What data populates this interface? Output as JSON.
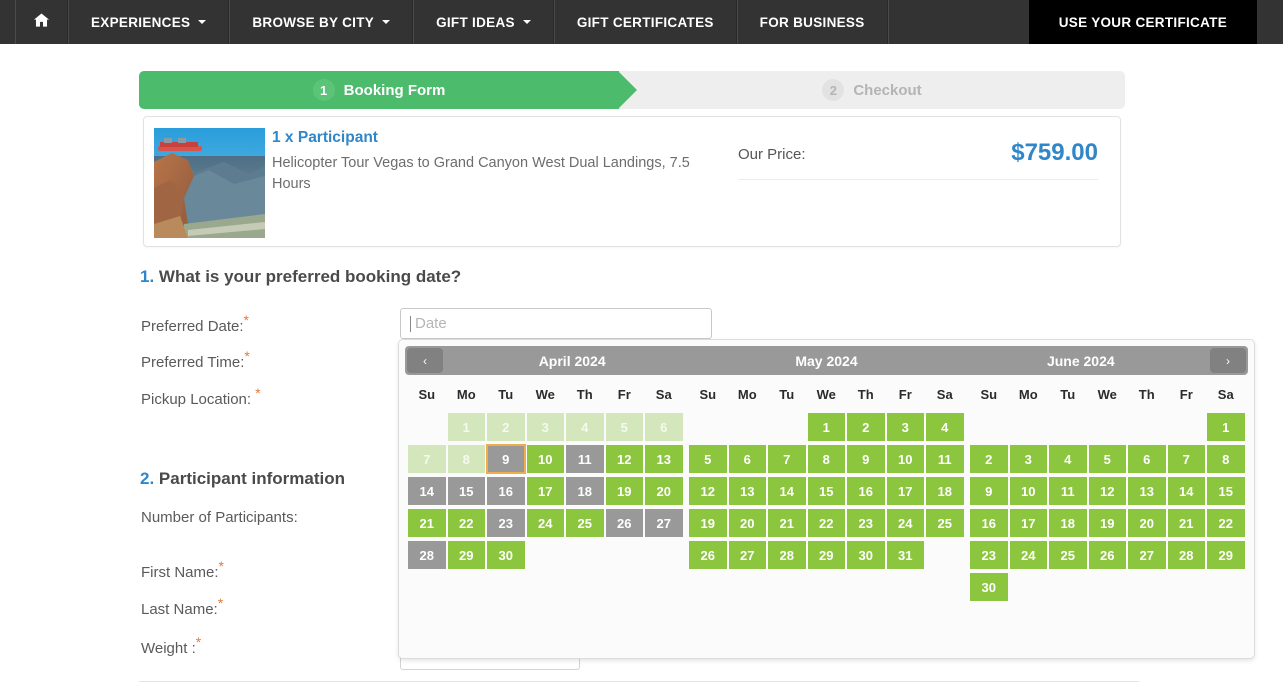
{
  "nav": {
    "home_icon": "home-icon",
    "items": [
      {
        "label": "EXPERIENCES",
        "has_caret": true
      },
      {
        "label": "BROWSE BY CITY",
        "has_caret": true
      },
      {
        "label": "GIFT IDEAS",
        "has_caret": true
      },
      {
        "label": "GIFT CERTIFICATES",
        "has_caret": false
      },
      {
        "label": "FOR BUSINESS",
        "has_caret": false
      }
    ],
    "cta_label": "USE YOUR CERTIFICATE"
  },
  "steps": [
    {
      "number": "1",
      "label": "Booking Form",
      "state": "active"
    },
    {
      "number": "2",
      "label": "Checkout",
      "state": "inactive"
    }
  ],
  "product": {
    "title": "1 x Participant",
    "description": "Helicopter Tour Vegas to Grand Canyon West Dual Landings, 7.5 Hours",
    "price_label": "Our Price:",
    "price_value": "$759.00",
    "thumb_alt": "grand-canyon-skywalk-photo"
  },
  "sections": [
    {
      "number": "1.",
      "heading": "What is your preferred booking date?",
      "fields": [
        {
          "label": "Preferred Date:",
          "required": "*"
        },
        {
          "label": "Preferred Time:",
          "required": "*"
        },
        {
          "label": "Pickup Location: ",
          "required": "*"
        }
      ]
    },
    {
      "number": "2.",
      "heading": "Participant information",
      "fields": [
        {
          "label": "Number of Participants:",
          "required": ""
        },
        {
          "label": "First Name:",
          "required": "*"
        },
        {
          "label": "Last Name:",
          "required": "*"
        },
        {
          "label": "Weight :",
          "required": "*"
        }
      ]
    }
  ],
  "date_input": {
    "value": "",
    "placeholder": "Date"
  },
  "datepicker": {
    "prev_label": "‹",
    "next_label": "›",
    "dow": [
      "Su",
      "Mo",
      "Tu",
      "We",
      "Th",
      "Fr",
      "Sa"
    ],
    "months": [
      {
        "title": "April 2024",
        "weeks": [
          [
            {
              "d": "",
              "s": "empty"
            },
            {
              "d": "1",
              "s": "disabled"
            },
            {
              "d": "2",
              "s": "disabled"
            },
            {
              "d": "3",
              "s": "disabled"
            },
            {
              "d": "4",
              "s": "disabled"
            },
            {
              "d": "5",
              "s": "disabled"
            },
            {
              "d": "6",
              "s": "disabled"
            }
          ],
          [
            {
              "d": "7",
              "s": "disabled"
            },
            {
              "d": "8",
              "s": "disabled"
            },
            {
              "d": "9",
              "s": "today"
            },
            {
              "d": "10",
              "s": "avail"
            },
            {
              "d": "11",
              "s": "unavail"
            },
            {
              "d": "12",
              "s": "avail"
            },
            {
              "d": "13",
              "s": "avail"
            }
          ],
          [
            {
              "d": "14",
              "s": "unavail"
            },
            {
              "d": "15",
              "s": "unavail"
            },
            {
              "d": "16",
              "s": "unavail"
            },
            {
              "d": "17",
              "s": "avail"
            },
            {
              "d": "18",
              "s": "unavail"
            },
            {
              "d": "19",
              "s": "avail"
            },
            {
              "d": "20",
              "s": "avail"
            }
          ],
          [
            {
              "d": "21",
              "s": "avail"
            },
            {
              "d": "22",
              "s": "avail"
            },
            {
              "d": "23",
              "s": "unavail"
            },
            {
              "d": "24",
              "s": "avail"
            },
            {
              "d": "25",
              "s": "avail"
            },
            {
              "d": "26",
              "s": "unavail"
            },
            {
              "d": "27",
              "s": "unavail"
            }
          ],
          [
            {
              "d": "28",
              "s": "unavail"
            },
            {
              "d": "29",
              "s": "avail"
            },
            {
              "d": "30",
              "s": "avail"
            },
            {
              "d": "",
              "s": "empty"
            },
            {
              "d": "",
              "s": "empty"
            },
            {
              "d": "",
              "s": "empty"
            },
            {
              "d": "",
              "s": "empty"
            }
          ],
          [
            {
              "d": "",
              "s": "empty"
            },
            {
              "d": "",
              "s": "empty"
            },
            {
              "d": "",
              "s": "empty"
            },
            {
              "d": "",
              "s": "empty"
            },
            {
              "d": "",
              "s": "empty"
            },
            {
              "d": "",
              "s": "empty"
            },
            {
              "d": "",
              "s": "empty"
            }
          ]
        ]
      },
      {
        "title": "May 2024",
        "weeks": [
          [
            {
              "d": "",
              "s": "empty"
            },
            {
              "d": "",
              "s": "empty"
            },
            {
              "d": "",
              "s": "empty"
            },
            {
              "d": "1",
              "s": "avail"
            },
            {
              "d": "2",
              "s": "avail"
            },
            {
              "d": "3",
              "s": "avail"
            },
            {
              "d": "4",
              "s": "avail"
            }
          ],
          [
            {
              "d": "5",
              "s": "avail"
            },
            {
              "d": "6",
              "s": "avail"
            },
            {
              "d": "7",
              "s": "avail"
            },
            {
              "d": "8",
              "s": "avail"
            },
            {
              "d": "9",
              "s": "avail"
            },
            {
              "d": "10",
              "s": "avail"
            },
            {
              "d": "11",
              "s": "avail"
            }
          ],
          [
            {
              "d": "12",
              "s": "avail"
            },
            {
              "d": "13",
              "s": "avail"
            },
            {
              "d": "14",
              "s": "avail"
            },
            {
              "d": "15",
              "s": "avail"
            },
            {
              "d": "16",
              "s": "avail"
            },
            {
              "d": "17",
              "s": "avail"
            },
            {
              "d": "18",
              "s": "avail"
            }
          ],
          [
            {
              "d": "19",
              "s": "avail"
            },
            {
              "d": "20",
              "s": "avail"
            },
            {
              "d": "21",
              "s": "avail"
            },
            {
              "d": "22",
              "s": "avail"
            },
            {
              "d": "23",
              "s": "avail"
            },
            {
              "d": "24",
              "s": "avail"
            },
            {
              "d": "25",
              "s": "avail"
            }
          ],
          [
            {
              "d": "26",
              "s": "avail"
            },
            {
              "d": "27",
              "s": "avail"
            },
            {
              "d": "28",
              "s": "avail"
            },
            {
              "d": "29",
              "s": "avail"
            },
            {
              "d": "30",
              "s": "avail"
            },
            {
              "d": "31",
              "s": "avail"
            },
            {
              "d": "",
              "s": "empty"
            }
          ],
          [
            {
              "d": "",
              "s": "empty"
            },
            {
              "d": "",
              "s": "empty"
            },
            {
              "d": "",
              "s": "empty"
            },
            {
              "d": "",
              "s": "empty"
            },
            {
              "d": "",
              "s": "empty"
            },
            {
              "d": "",
              "s": "empty"
            },
            {
              "d": "",
              "s": "empty"
            }
          ]
        ]
      },
      {
        "title": "June 2024",
        "weeks": [
          [
            {
              "d": "",
              "s": "empty"
            },
            {
              "d": "",
              "s": "empty"
            },
            {
              "d": "",
              "s": "empty"
            },
            {
              "d": "",
              "s": "empty"
            },
            {
              "d": "",
              "s": "empty"
            },
            {
              "d": "",
              "s": "empty"
            },
            {
              "d": "1",
              "s": "avail"
            }
          ],
          [
            {
              "d": "2",
              "s": "avail"
            },
            {
              "d": "3",
              "s": "avail"
            },
            {
              "d": "4",
              "s": "avail"
            },
            {
              "d": "5",
              "s": "avail"
            },
            {
              "d": "6",
              "s": "avail"
            },
            {
              "d": "7",
              "s": "avail"
            },
            {
              "d": "8",
              "s": "avail"
            }
          ],
          [
            {
              "d": "9",
              "s": "avail"
            },
            {
              "d": "10",
              "s": "avail"
            },
            {
              "d": "11",
              "s": "avail"
            },
            {
              "d": "12",
              "s": "avail"
            },
            {
              "d": "13",
              "s": "avail"
            },
            {
              "d": "14",
              "s": "avail"
            },
            {
              "d": "15",
              "s": "avail"
            }
          ],
          [
            {
              "d": "16",
              "s": "avail"
            },
            {
              "d": "17",
              "s": "avail"
            },
            {
              "d": "18",
              "s": "avail"
            },
            {
              "d": "19",
              "s": "avail"
            },
            {
              "d": "20",
              "s": "avail"
            },
            {
              "d": "21",
              "s": "avail"
            },
            {
              "d": "22",
              "s": "avail"
            }
          ],
          [
            {
              "d": "23",
              "s": "avail"
            },
            {
              "d": "24",
              "s": "avail"
            },
            {
              "d": "25",
              "s": "avail"
            },
            {
              "d": "26",
              "s": "avail"
            },
            {
              "d": "27",
              "s": "avail"
            },
            {
              "d": "28",
              "s": "avail"
            },
            {
              "d": "29",
              "s": "avail"
            }
          ],
          [
            {
              "d": "30",
              "s": "avail"
            },
            {
              "d": "",
              "s": "empty"
            },
            {
              "d": "",
              "s": "empty"
            },
            {
              "d": "",
              "s": "empty"
            },
            {
              "d": "",
              "s": "empty"
            },
            {
              "d": "",
              "s": "empty"
            },
            {
              "d": "",
              "s": "empty"
            }
          ]
        ]
      }
    ]
  },
  "colors": {
    "nav_bg": "#333333",
    "cta_bg": "#000000",
    "step_active": "#4cbb6c",
    "step_inactive": "#eeeeee",
    "accent_blue": "#2f86c9",
    "day_available": "#8cc63e",
    "day_unavailable": "#999999",
    "day_disabled": "#d4e7bc",
    "today_outline": "#f0ad4e"
  }
}
